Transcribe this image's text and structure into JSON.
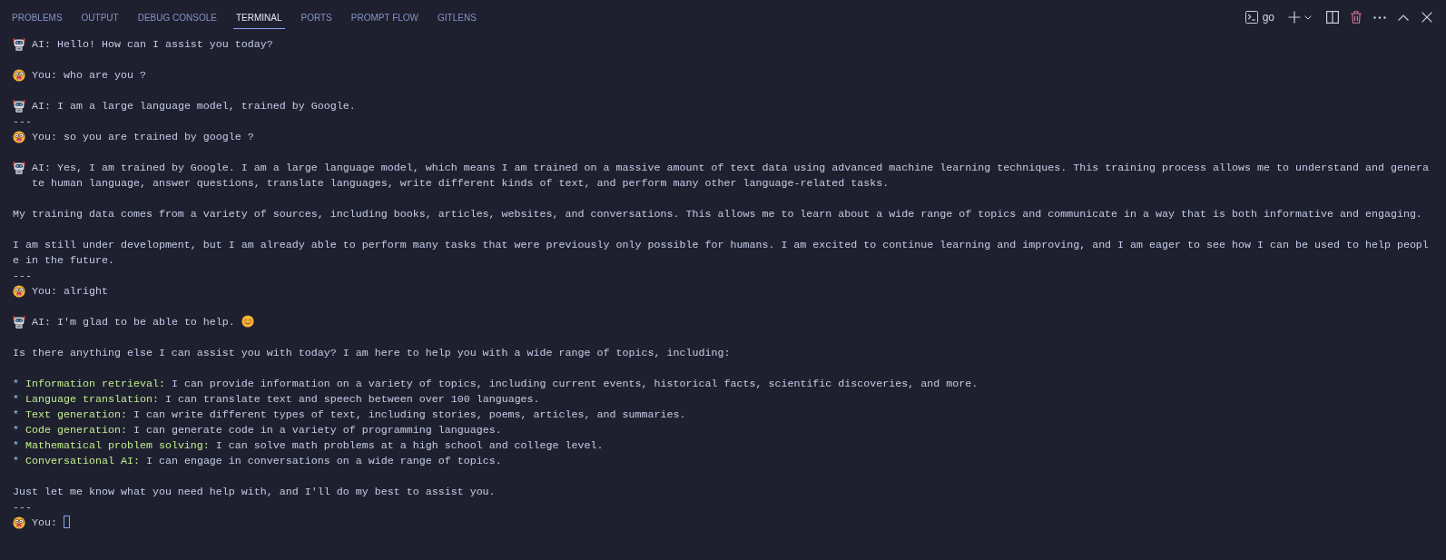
{
  "panel_tabs": [
    {
      "label": "PROBLEMS",
      "selected": false
    },
    {
      "label": "OUTPUT",
      "selected": false
    },
    {
      "label": "DEBUG CONSOLE",
      "selected": false
    },
    {
      "label": "TERMINAL",
      "selected": true
    },
    {
      "label": "PORTS",
      "selected": false
    },
    {
      "label": "PROMPT FLOW",
      "selected": false
    },
    {
      "label": "GITLENS",
      "selected": false
    }
  ],
  "toolbar": {
    "profile": "go"
  },
  "terminal": {
    "blocks": [
      {
        "lines": [
          {
            "kind": "ai",
            "text": "AI: Hello! How can I assist you today?"
          }
        ]
      },
      {
        "lines": [
          {
            "kind": "you",
            "text": "You: who are you ?"
          }
        ]
      },
      {
        "lines": [
          {
            "kind": "ai",
            "text": "AI: I am a large language model, trained by Google."
          },
          {
            "kind": "separator",
            "text": "---"
          },
          {
            "kind": "you",
            "text": "You: so you are trained by google ?"
          }
        ]
      },
      {
        "lines": [
          {
            "kind": "ai",
            "text": "AI: Yes, I am trained by Google. I am a large language model, which means I am trained on a massive amount of text data using advanced machine learning techniques. This training process allows me to understand and generate human language, answer questions, translate languages, write different kinds of text, and perform many other language-related tasks."
          }
        ]
      },
      {
        "lines": [
          {
            "kind": "plain",
            "text": "My training data comes from a variety of sources, including books, articles, websites, and conversations. This allows me to learn about a wide range of topics and communicate in a way that is both informative and engaging."
          }
        ]
      },
      {
        "lines": [
          {
            "kind": "plain",
            "text": "I am still under development, but I am already able to perform many tasks that were previously only possible for humans. I am excited to continue learning and improving, and I am eager to see how I can be used to help people in the future."
          },
          {
            "kind": "separator",
            "text": "---"
          },
          {
            "kind": "you",
            "text": "You: alright"
          }
        ]
      },
      {
        "lines": [
          {
            "kind": "ai",
            "text": "AI: I'm glad to be able to help.",
            "smiley": true
          }
        ]
      },
      {
        "lines": [
          {
            "kind": "plain",
            "text": "Is there anything else I can assist you with today? I am here to help you with a wide range of topics, including:"
          }
        ]
      },
      {
        "lines": [
          {
            "kind": "bullet",
            "bullet": "*",
            "term": "Information retrieval:",
            "text": "I can provide information on a variety of topics, including current events, historical facts, scientific discoveries, and more."
          },
          {
            "kind": "bullet",
            "bullet": "*",
            "term": "Language translation:",
            "text": "I can translate text and speech between over 100 languages."
          },
          {
            "kind": "bullet",
            "bullet": "*",
            "term": "Text generation:",
            "text": "I can write different types of text, including stories, poems, articles, and summaries."
          },
          {
            "kind": "bullet",
            "bullet": "*",
            "term": "Code generation:",
            "text": "I can generate code in a variety of programming languages."
          },
          {
            "kind": "bullet",
            "bullet": "*",
            "term": "Mathematical problem solving:",
            "text": "I can solve math problems at a high school and college level."
          },
          {
            "kind": "bullet",
            "bullet": "*",
            "term": "Conversational AI:",
            "text": "I can engage in conversations on a wide range of topics."
          }
        ]
      },
      {
        "lines": [
          {
            "kind": "plain",
            "text": "Just let me know what you need help with, and I'll do my best to assist you."
          },
          {
            "kind": "separator",
            "text": "---"
          },
          {
            "kind": "you",
            "text": "You:",
            "cursor": true
          }
        ]
      }
    ]
  }
}
